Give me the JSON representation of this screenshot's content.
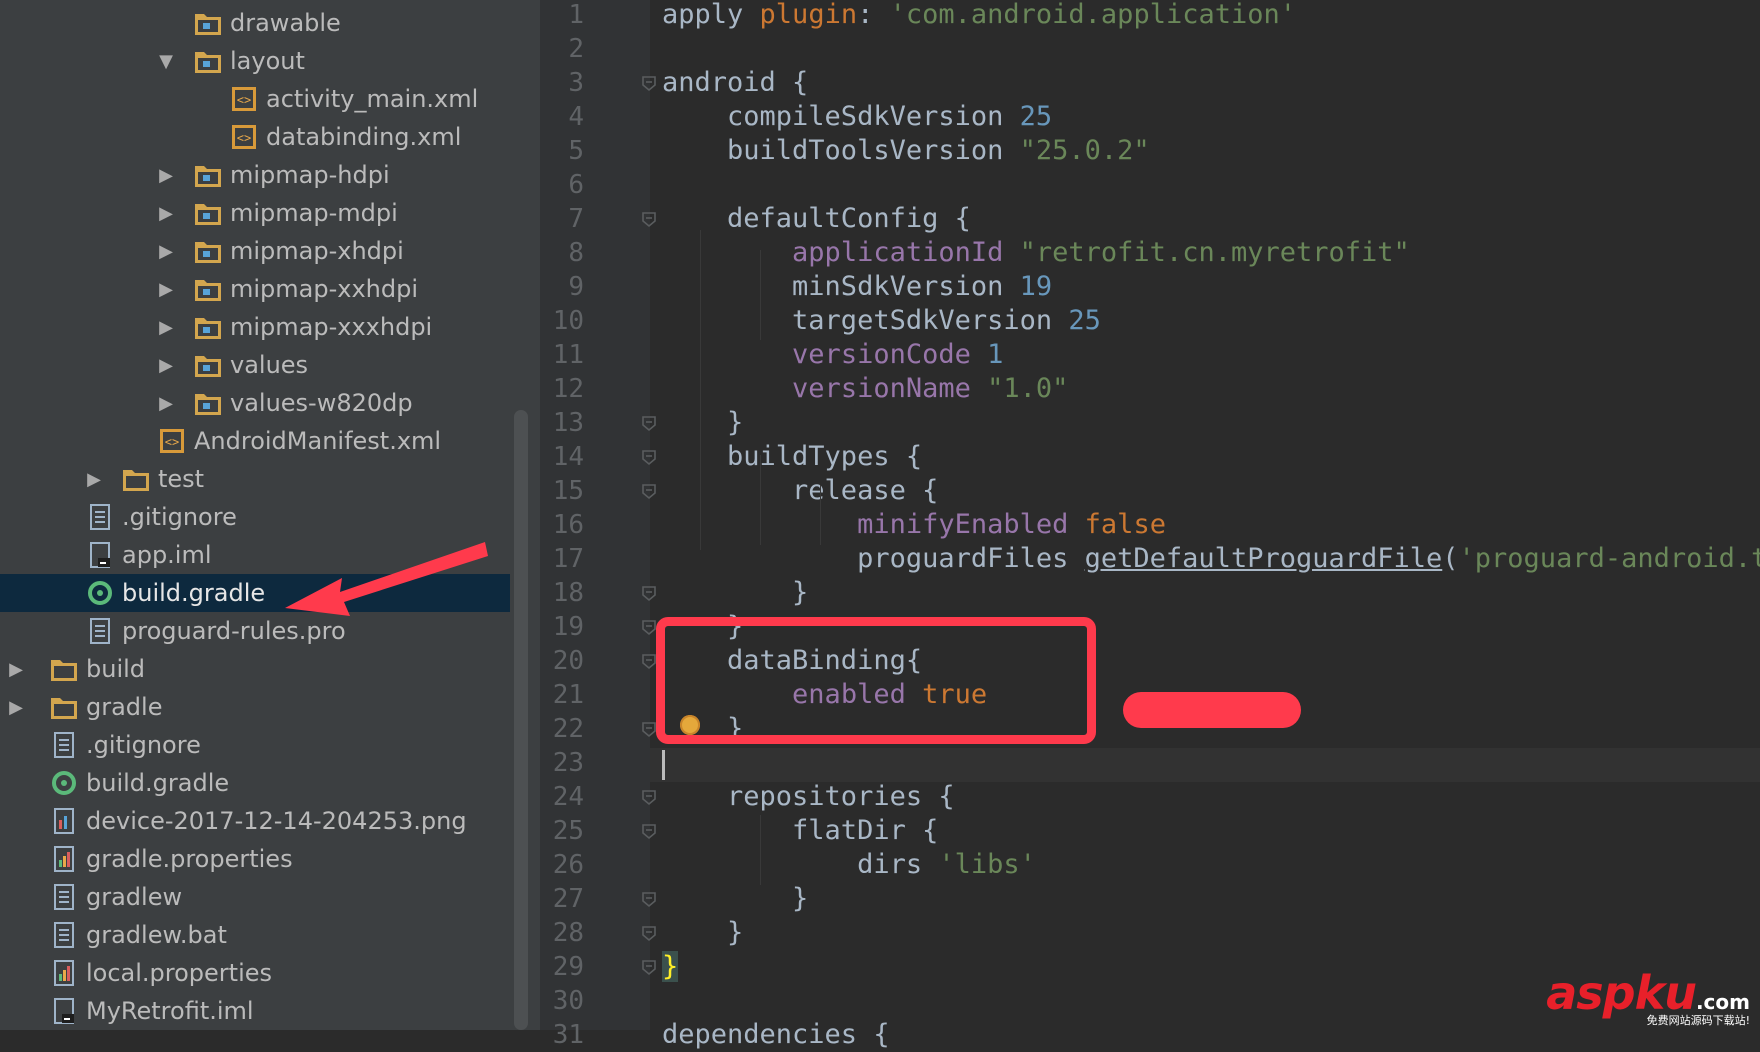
{
  "tree": {
    "items": [
      {
        "label": "drawable",
        "icon": "folder-res-icon",
        "arrow": ""
      },
      {
        "label": "layout",
        "icon": "folder-res-icon",
        "arrow": "expanded"
      },
      {
        "label": "activity_main.xml",
        "icon": "xml-file-icon",
        "arrow": ""
      },
      {
        "label": "databinding.xml",
        "icon": "xml-file-icon",
        "arrow": ""
      },
      {
        "label": "mipmap-hdpi",
        "icon": "folder-res-icon",
        "arrow": "collapsed"
      },
      {
        "label": "mipmap-mdpi",
        "icon": "folder-res-icon",
        "arrow": "collapsed"
      },
      {
        "label": "mipmap-xhdpi",
        "icon": "folder-res-icon",
        "arrow": "collapsed"
      },
      {
        "label": "mipmap-xxhdpi",
        "icon": "folder-res-icon",
        "arrow": "collapsed"
      },
      {
        "label": "mipmap-xxxhdpi",
        "icon": "folder-res-icon",
        "arrow": "collapsed"
      },
      {
        "label": "values",
        "icon": "folder-res-icon",
        "arrow": "collapsed"
      },
      {
        "label": "values-w820dp",
        "icon": "folder-res-icon",
        "arrow": "collapsed"
      },
      {
        "label": "AndroidManifest.xml",
        "icon": "xml-file-icon",
        "arrow": ""
      },
      {
        "label": "test",
        "icon": "folder-icon",
        "arrow": "collapsed"
      },
      {
        "label": ".gitignore",
        "icon": "text-file-icon",
        "arrow": ""
      },
      {
        "label": "app.iml",
        "icon": "iml-file-icon",
        "arrow": ""
      },
      {
        "label": "build.gradle",
        "icon": "gradle-icon",
        "arrow": "",
        "selected": true
      },
      {
        "label": "proguard-rules.pro",
        "icon": "text-file-icon",
        "arrow": ""
      },
      {
        "label": "build",
        "icon": "folder-icon",
        "arrow": "collapsed"
      },
      {
        "label": "gradle",
        "icon": "folder-icon",
        "arrow": "collapsed"
      },
      {
        "label": ".gitignore",
        "icon": "text-file-icon",
        "arrow": ""
      },
      {
        "label": "build.gradle",
        "icon": "gradle-icon",
        "arrow": ""
      },
      {
        "label": "device-2017-12-14-204253.png",
        "icon": "image-file-icon",
        "arrow": ""
      },
      {
        "label": "gradle.properties",
        "icon": "properties-file-icon",
        "arrow": ""
      },
      {
        "label": "gradlew",
        "icon": "text-file-icon",
        "arrow": ""
      },
      {
        "label": "gradlew.bat",
        "icon": "text-file-icon",
        "arrow": ""
      },
      {
        "label": "local.properties",
        "icon": "properties-file-icon",
        "arrow": ""
      },
      {
        "label": "MyRetrofit.iml",
        "icon": "iml-file-icon",
        "arrow": ""
      }
    ]
  },
  "editor": {
    "first_line": 1,
    "caret_line": 23,
    "lines": [
      [
        {
          "t": "apply "
        },
        {
          "t": "plugin",
          "c": "kw"
        },
        {
          "t": ": "
        },
        {
          "t": "'com.android.application'",
          "c": "st"
        }
      ],
      [],
      [
        {
          "t": "android {"
        }
      ],
      [
        {
          "t": "    compileSdkVersion "
        },
        {
          "t": "25",
          "c": "nu"
        }
      ],
      [
        {
          "t": "    buildToolsVersion "
        },
        {
          "t": "\"25.0.2\"",
          "c": "st"
        }
      ],
      [],
      [
        {
          "t": "    defaultConfig {"
        }
      ],
      [
        {
          "t": "        "
        },
        {
          "t": "applicationId",
          "c": "pr"
        },
        {
          "t": " "
        },
        {
          "t": "\"retrofit.cn.myretrofit\"",
          "c": "st"
        }
      ],
      [
        {
          "t": "        minSdkVersion "
        },
        {
          "t": "19",
          "c": "nu"
        }
      ],
      [
        {
          "t": "        targetSdkVersion "
        },
        {
          "t": "25",
          "c": "nu"
        }
      ],
      [
        {
          "t": "        "
        },
        {
          "t": "versionCode",
          "c": "pr"
        },
        {
          "t": " "
        },
        {
          "t": "1",
          "c": "nu"
        }
      ],
      [
        {
          "t": "        "
        },
        {
          "t": "versionName",
          "c": "pr"
        },
        {
          "t": " "
        },
        {
          "t": "\"1.0\"",
          "c": "st"
        }
      ],
      [
        {
          "t": "    }"
        }
      ],
      [
        {
          "t": "    buildTypes {"
        }
      ],
      [
        {
          "t": "        release {"
        }
      ],
      [
        {
          "t": "            "
        },
        {
          "t": "minifyEnabled",
          "c": "pr"
        },
        {
          "t": " "
        },
        {
          "t": "false",
          "c": "kw"
        }
      ],
      [
        {
          "t": "            proguardFiles "
        },
        {
          "t": "getDefaultProguardFile",
          "c": "fn"
        },
        {
          "t": "("
        },
        {
          "t": "'proguard-android.tx",
          "c": "st"
        }
      ],
      [
        {
          "t": "        }"
        }
      ],
      [
        {
          "t": "    }"
        }
      ],
      [
        {
          "t": "    dataBinding{"
        }
      ],
      [
        {
          "t": "        "
        },
        {
          "t": "enabled",
          "c": "pr"
        },
        {
          "t": " "
        },
        {
          "t": "true",
          "c": "kw"
        }
      ],
      [
        {
          "t": "    }"
        }
      ],
      [],
      [
        {
          "t": "    repositories {"
        }
      ],
      [
        {
          "t": "        flatDir {"
        }
      ],
      [
        {
          "t": "            dirs "
        },
        {
          "t": "'libs'",
          "c": "st"
        }
      ],
      [
        {
          "t": "        }"
        }
      ],
      [
        {
          "t": "    }"
        }
      ],
      [
        {
          "t": "}",
          "c": "bm"
        }
      ],
      [],
      [
        {
          "t": "dependencies {"
        }
      ]
    ],
    "fold_markers": [
      3,
      7,
      13,
      14,
      15,
      18,
      19,
      20,
      22,
      24,
      25,
      27,
      28,
      29
    ]
  },
  "annotations": {
    "arrow_color": "#ff3a4c",
    "box_color": "#ff3a4c"
  },
  "watermark": {
    "brand": "aspku",
    "tld": ".com",
    "tagline": "免费网站源码下载站!"
  }
}
